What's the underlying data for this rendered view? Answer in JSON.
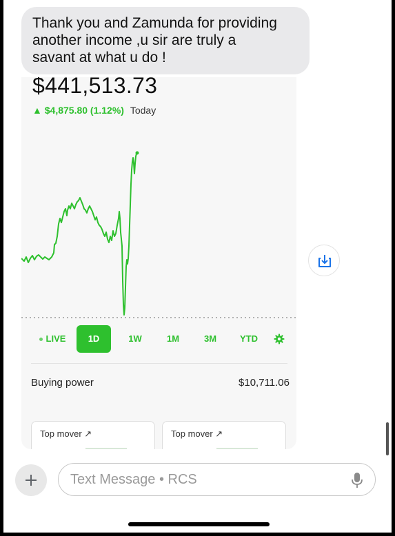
{
  "message": {
    "line1": "Thank you and Zamunda for providing",
    "line2": "another income  ,u sir are truly a",
    "line3": "savant at what u do !"
  },
  "portfolio": {
    "balance": "$441,513.73",
    "change": "▲ $4,875.80 (1.12%)",
    "change_period": "Today",
    "accent_color": "#2ec02e",
    "ranges": [
      {
        "label": "LIVE",
        "active": false
      },
      {
        "label": "1D",
        "active": true
      },
      {
        "label": "1W",
        "active": false
      },
      {
        "label": "1M",
        "active": false
      },
      {
        "label": "3M",
        "active": false
      },
      {
        "label": "YTD",
        "active": false
      }
    ],
    "settings_icon": "gear-icon",
    "buying_power_label": "Buying power",
    "buying_power_value": "$10,711.06",
    "movers": [
      {
        "label": "Top mover ↗"
      },
      {
        "label": "Top mover ↗"
      }
    ]
  },
  "compose": {
    "placeholder": "Text Message • RCS",
    "add_icon": "plus-icon",
    "mic_icon": "microphone-icon"
  },
  "download_icon": "download-icon"
}
